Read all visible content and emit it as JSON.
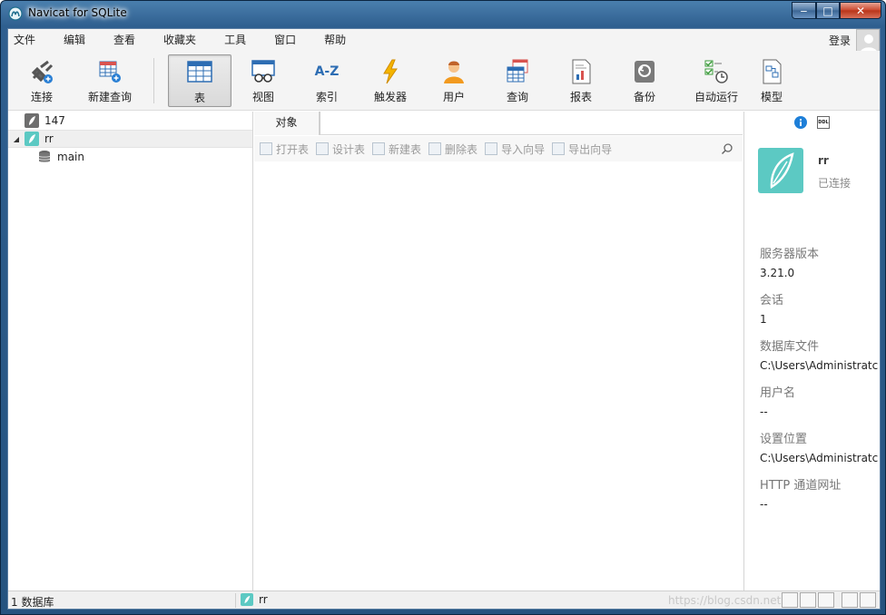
{
  "window": {
    "title": "Navicat for SQLite",
    "controls": {
      "minimize": "‒",
      "maximize": "□",
      "close": "✕"
    }
  },
  "menu": {
    "items": [
      "文件",
      "编辑",
      "查看",
      "收藏夹",
      "工具",
      "窗口",
      "帮助"
    ],
    "login_label": "登录"
  },
  "toolbar": {
    "buttons": [
      {
        "label": "连接",
        "icon": "connect-plug-icon"
      },
      {
        "label": "新建查询",
        "icon": "new-query-icon"
      },
      {
        "label": "表",
        "icon": "table-icon",
        "active": true
      },
      {
        "label": "视图",
        "icon": "view-glasses-icon"
      },
      {
        "label": "索引",
        "icon": "index-az-icon",
        "glyph": "A-Z"
      },
      {
        "label": "触发器",
        "icon": "trigger-lightning-icon"
      },
      {
        "label": "用户",
        "icon": "user-icon"
      },
      {
        "label": "查询",
        "icon": "query-icon"
      },
      {
        "label": "报表",
        "icon": "report-icon"
      },
      {
        "label": "备份",
        "icon": "backup-icon"
      },
      {
        "label": "自动运行",
        "icon": "automation-icon"
      },
      {
        "label": "模型",
        "icon": "model-icon"
      }
    ]
  },
  "navigator": {
    "items": [
      {
        "label": "147",
        "type": "connection",
        "color": "#6e6e6e"
      },
      {
        "label": "rr",
        "type": "connection",
        "color": "#5cc9c3",
        "expanded": true,
        "expander": "◢"
      },
      {
        "label": "main",
        "type": "database"
      }
    ]
  },
  "objects": {
    "tab_label": "对象",
    "actions": [
      {
        "label": "打开表",
        "icon": "open-table-icon"
      },
      {
        "label": "设计表",
        "icon": "design-table-icon"
      },
      {
        "label": "新建表",
        "icon": "new-table-icon"
      },
      {
        "label": "删除表",
        "icon": "delete-table-icon"
      },
      {
        "label": "导入向导",
        "icon": "import-wizard-icon"
      },
      {
        "label": "导出向导",
        "icon": "export-wizard-icon"
      }
    ]
  },
  "info_panel": {
    "ddl_label": "DDL",
    "connection_name": "rr",
    "connection_status": "已连接",
    "fields": [
      {
        "key": "服务器版本",
        "value": "3.21.0"
      },
      {
        "key": "会话",
        "value": "1"
      },
      {
        "key": "数据库文件",
        "value": "C:\\Users\\Administratc"
      },
      {
        "key": "用户名",
        "value": "--"
      },
      {
        "key": "设置位置",
        "value": "C:\\Users\\Administratc"
      },
      {
        "key": "HTTP 通道网址",
        "value": "--"
      }
    ]
  },
  "status": {
    "db_count": "1 数据库",
    "connection": "rr",
    "watermark": "https://blog.csdn.net"
  },
  "colors": {
    "accent_teal": "#5cc9c3",
    "title_blue": "#2f5f8f"
  }
}
